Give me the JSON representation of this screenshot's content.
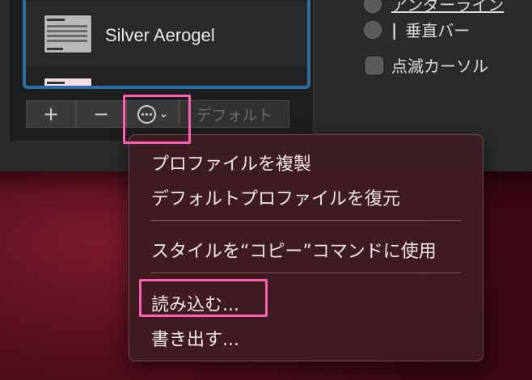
{
  "profiles": [
    {
      "name": "Silver Aerogel",
      "selected": true
    },
    {
      "name": "",
      "selected": false
    }
  ],
  "toolbar": {
    "add_label": "+",
    "remove_label": "−",
    "action_icon": "ellipsis-circle-icon",
    "default_label": "デフォルト"
  },
  "cursor_options": {
    "underline_label": "アンダーライン",
    "vertical_bar_label": "垂直バー",
    "blink_label": "点滅カーソル"
  },
  "context_menu": {
    "items": [
      {
        "label": "プロファイルを複製"
      },
      {
        "label": "デフォルトプロファイルを復元"
      },
      {
        "label": "スタイルを“コピー”コマンドに使用"
      },
      {
        "label": "読み込む..."
      },
      {
        "label": "書き出す..."
      }
    ]
  },
  "colors": {
    "selection_border": "#2c6fa6",
    "highlight_annotation": "#ff5fb0",
    "menu_background": "#3e1c22"
  }
}
